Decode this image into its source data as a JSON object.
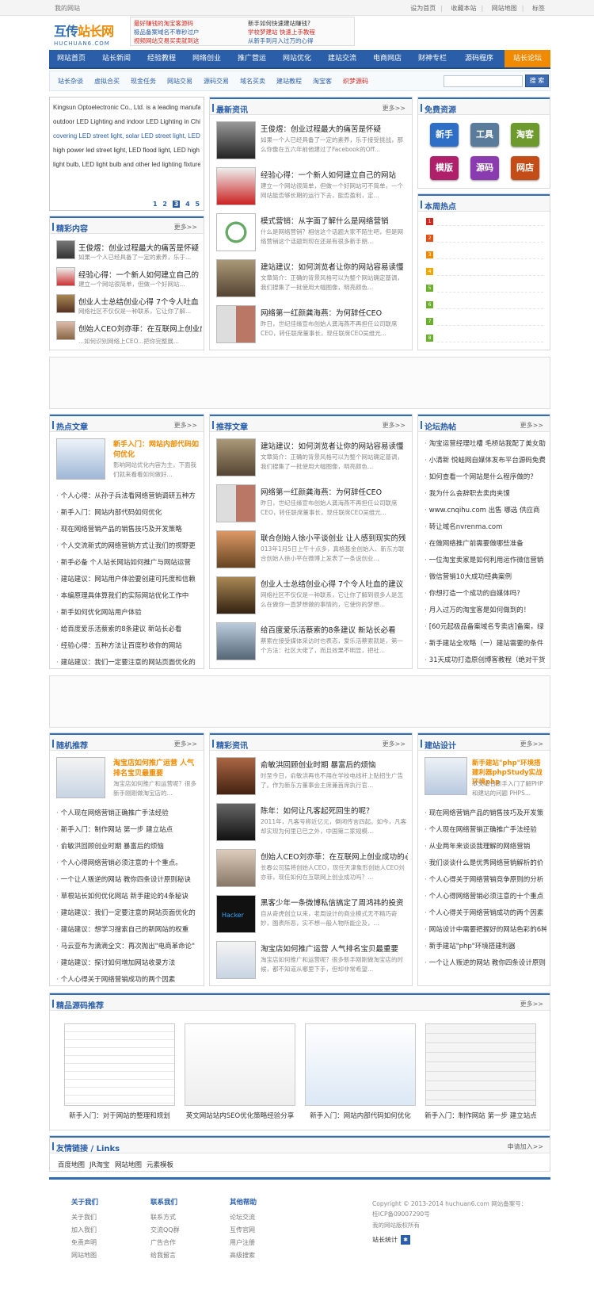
{
  "topbar": {
    "site": "我的网站",
    "links": [
      "设为首页",
      "收藏本站",
      "网站地图",
      "标签"
    ]
  },
  "logo": {
    "cn_a": "互传",
    "cn_b": "站长网",
    "en": "HUCHUAN6.COM"
  },
  "ads": {
    "c1": [
      "最好赚钱的淘宝客源码",
      "极品备案域名不靠秒过户",
      "视频网站交易买卖就到这"
    ],
    "c2": [
      "新手如何快速建站赚钱?",
      "学校梦建站 快速上手教程",
      "从新手到月入过万的心得"
    ]
  },
  "nav": {
    "items": [
      "网站首页",
      "站长新闻",
      "经验教程",
      "网络创业",
      "推广营运",
      "网站优化",
      "建站交流",
      "电商网店",
      "财神专栏",
      "源码程序",
      "站长论坛"
    ]
  },
  "subnav": {
    "items": [
      "站长杂谈",
      "虚拟合买",
      "现金任务",
      "网站交易",
      "源码交易",
      "域名买卖",
      "建站教程",
      "淘宝客",
      "织梦源码"
    ],
    "search_placeholder": "",
    "search_btn": "搜 索"
  },
  "slider": {
    "text": [
      "Kingsun Optoelectronic Co., Ltd. is a leading manufacturer in both",
      "outdoor LED Lighting and indoor LED Lighting in China, products widely",
      "covering LED street light, solar LED street light, LED tunnel light,",
      "high power led street light, LED flood light, LED high bay light, LED",
      "light bulb, LED light bulb and other led lighting fixtures."
    ],
    "pages": [
      "1",
      "2",
      "3",
      "4",
      "5"
    ],
    "active_page": "3"
  },
  "jingcai": {
    "title": "精彩内容",
    "more": "更多>>",
    "items": [
      {
        "t": "王俊煜：创业过程最大的痛苦是怀疑",
        "d": "如果一个人已经具备了一定的素养，乐于..."
      },
      {
        "t": "经验心得：一个新人如何建立自己的",
        "d": "建立一个网站很简单，但做一个好网站..."
      },
      {
        "t": "创业人士总结创业心得 7个令人吐血",
        "d": "网络社区不仅仅是一种联系，它让你了解..."
      },
      {
        "t": "创始人CEO刘亦菲：在互联网上创业成",
        "d": "...如何识别网络上CEO...把你完整展..."
      }
    ]
  },
  "zuixin": {
    "title": "最新资讯",
    "more": "更多>>",
    "items": [
      {
        "t": "王俊煜：创业过程最大的痛苦是怀疑",
        "d": "如果一个人已经具备了一定的素养，乐于接受挑战，那么你像在五六年前他建过了Facebook的Off..."
      },
      {
        "t": "经验心得：一个新人如何建立自己的网站",
        "d": "建立一个网站很简单，但做一个好网站可不简单，一个网站能否够长期的运行下去，能否盈利，定..."
      },
      {
        "t": "模式营销：从字面了解什么是网络营销",
        "d": "什么是网络营销？相信这个话题大家不陌生吧，但是网络营销这个话题到现在还是有很多新手朋..."
      },
      {
        "t": "建站建议：如何浏览者让你的网站容易读懂",
        "d": "文章简介：正确的背景风格可以为整个网站确定基调，我们搜集了一批使用大幅图像，明亮颜色..."
      },
      {
        "t": "网络第一红颜龚海燕：为何辞任CEO",
        "d": "昨日，世纪佳缘宣布创始人龚海燕不再担任公司联席CEO，转任联席董事长，现任联席CEO吴维光..."
      }
    ]
  },
  "mianfei": {
    "title": "免费资源",
    "items": [
      "新手",
      "工具",
      "淘客",
      "模版",
      "源码",
      "网店"
    ]
  },
  "benzhou": {
    "title": "本周热点",
    "badges": [
      "1",
      "2",
      "3",
      "4",
      "5",
      "6",
      "7",
      "8"
    ]
  },
  "redian": {
    "title": "热点文章",
    "more": "更多>>",
    "feature": {
      "t": "新手入门：网站内部代码如何优化",
      "d": "影响网站优化内容为主，下面我们就来看看如何做好..."
    },
    "items": [
      "个人心得：从孙子兵法看网络营销调研五种方",
      "新手入门：网站内部代码如何优化",
      "现在网络营销产品的销售技巧及开发策略",
      "个人交流新式的网络营销方式让我们的视野更",
      "新手必备 个人站长网站如何推广与网站运营",
      "建站建议：网站用户体验要创建可托度和信赖",
      "本编原理具体算我们的实际网站优化工作中",
      "新手如何优化网站用户体验",
      "给百度爱乐活蔡索的8条建议 新站长必看",
      "经验心得：五种方法让百度秒收你的网站",
      "建站建议：我们一定要注意的网站页面优化的"
    ]
  },
  "tuijian": {
    "title": "推荐文章",
    "more": "更多>>",
    "items": [
      {
        "t": "建站建议：如何浏览者让你的网站容易读懂",
        "d": "文章简介：正确的背景风格可以为整个网站确定基调，我们搜集了一批使用大幅图像，明亮颜色..."
      },
      {
        "t": "网络第一红颜龚海燕：为何辞任CEO",
        "d": "昨日，世纪佳缘宣布创始人龚海燕不再担任公司联席CEO，转任联席董事长，现任联席CEO吴维光..."
      },
      {
        "t": "联合创始人徐小平谈创业 让人感到现实的残",
        "d": "013年1月5日上午十点多，真格基金创始人、新东方联合创始人徐小平在微博上发表了一条说创业..."
      },
      {
        "t": "创业人士总结创业心得 7个令人吐血的建议",
        "d": "网络社区不仅仅是一种联系，它让你了解到很多人是怎么在做你一直梦想做的事情的，它使你的梦想..."
      },
      {
        "t": "给百度爱乐活蔡索的8条建议 新站长必看",
        "d": "蔡索在接受媒体采访时也表态，爱乐活蔡索就是，第一个方法：社区大佬了，而且效果不明显，把社..."
      }
    ]
  },
  "luntan": {
    "title": "论坛热帖",
    "more": "更多>>",
    "items": [
      "淘宝运营经理吐槽 毛桥站我配了美女助",
      "小清新 悦蛙网自媒体发布平台源码免费",
      "如何查看一个网站是什么程序做的？",
      "我为什么会辞职去卖肉夹馍",
      "www.cnqihu.com 出售 哪选 供应商",
      "转让域名nvrenma.com",
      "在做网络推广前需要做哪些准备",
      "一位淘宝卖家是如何利用运作微信营销",
      "微信营销10大成功经典案例",
      "你想打造一个成功的自媒体吗？",
      "月入过万的淘宝客是如何做到的！",
      "[60元起极品备案域名专卖店]备案，绿",
      "新手建站全攻略（一）建站需要的条件",
      "31天成功打造原创博客教程（绝对干货"
    ]
  },
  "suiji": {
    "title": "随机推荐",
    "more": "更多>>",
    "feature": {
      "t": "淘宝店如何推广运营 人气排名宝贝最重要",
      "d": "淘宝店如何推广和运营呢？很多新手刚刚做淘宝店的..."
    },
    "items": [
      "个人现在网络营销正确推广手法经验",
      "新手入门：制作网站 第一步 建立站点",
      "俞敏洪回顾创业时期 暴富后的烦恼",
      "个人心得网络营销必须注意的十个重点。",
      "一个让人叛逆的网站 教你四条设计原则秘诀",
      "草根站长如何优化网站 新手建论的4条秘诀",
      "建站建议：我们一定要注意的网站页面优化的",
      "建站建议：想学习搜索自己的新网站的权重",
      "马云亚布为滴滴全文：再次抛出\"电商革命论\"",
      "建站建议：探讨如何增加网站收录方法",
      "个人心得关于网络营销成功的两个因素"
    ]
  },
  "jingxuan": {
    "title": "精彩资讯",
    "more": "更多>>",
    "items": [
      {
        "t": "俞敏洪回顾创业时期 暴富后的烦恼",
        "d": "时至今日，俞敏洪再也不用在学校电线杆上贴招生广告了。作为新东方董事会主席兼首席执行官..."
      },
      {
        "t": "陈年：如何让凡客起死回生的呢？",
        "d": "2011年，凡客号称近亿元，倒闭传言四起。如今，凡客却实现为何里已巳之外，中国第二家规模..."
      },
      {
        "t": "创始人CEO刘亦菲：在互联网上创业成功的心",
        "d": "长春公司猛将创始人CEO，现任天津象形创始人CEO刘亦菲，现任如何在互联网上创业成功吗？..."
      },
      {
        "t": "黑客少年一条微博私信搞定了周鸿祎的投资",
        "d": "自从奇虎创立以来，老周设计的商业模式无不精巧奇妙，图表所恶，实不想一般人物所能企及，..."
      },
      {
        "t": "淘宝店如何推广运营 人气排名宝贝最重要",
        "d": "淘宝店如何推广和运营呢？很多新手刚刚做淘宝店的时候，都不知道从哪里下手，但却非常希望..."
      }
    ]
  },
  "jianzhan": {
    "title": "建站设计",
    "more": "更多>>",
    "feature": {
      "t": "新手建站\"php\"环境搭建利器phpStudy实战环境php",
      "d": "本文适合新手入门了解PHP和建站的问题 PHPS..."
    },
    "items": [
      "现在网络营销产品的销售技巧及开发策",
      "个人现在网络营销正确推广手法经验",
      "从业两年来谈谈我理解的网络营销",
      "我们谈谈什么是优秀网络营销解析的价",
      "个人心得关于网络营销竞争原则的分析",
      "个人心得网络营销必须注意的十个重点",
      "个人心得关于网络营销成功的两个因素",
      "网站设计中需要把握好的网站色彩的6种",
      "新手建站\"php\"环境搭建利器",
      "一个让人叛逆的网站 教你四条设计原则"
    ]
  },
  "yuanma": {
    "title": "精品源码推荐",
    "more": "更多>>",
    "captions": [
      "新手入门：对于网站的整理和规划",
      "英文网站站内SEO优化策略经验分享",
      "新手入门：网站内部代码如何优化",
      "新手入门：制作网站 第一步 建立站点"
    ]
  },
  "youqing": {
    "title": "友情链接 / Links",
    "more": "申请加入>>",
    "links": [
      "百度地图",
      "JR淘宝",
      "网站地图",
      "元素模板"
    ]
  },
  "footer": {
    "cols": [
      {
        "h": "关于我们",
        "items": [
          "关于我们",
          "加入我们",
          "免责声明",
          "网站地图"
        ]
      },
      {
        "h": "联系我们",
        "items": [
          "联系方式",
          "交流QQ群",
          "广告合作",
          "给我留言"
        ]
      },
      {
        "h": "其他帮助",
        "items": [
          "论坛交流",
          "互传官网",
          "用户注册",
          "高级搜索"
        ]
      }
    ],
    "copyright": "Copyright © 2013-2014 huchuan6.com 网站备案号：桂ICP备09007290号",
    "rights": "我的网站版权所有",
    "stat": "站长统计"
  },
  "colors": {
    "nav": "#2a5ea8",
    "accent": "#f08a00",
    "red": "#d3271e"
  }
}
